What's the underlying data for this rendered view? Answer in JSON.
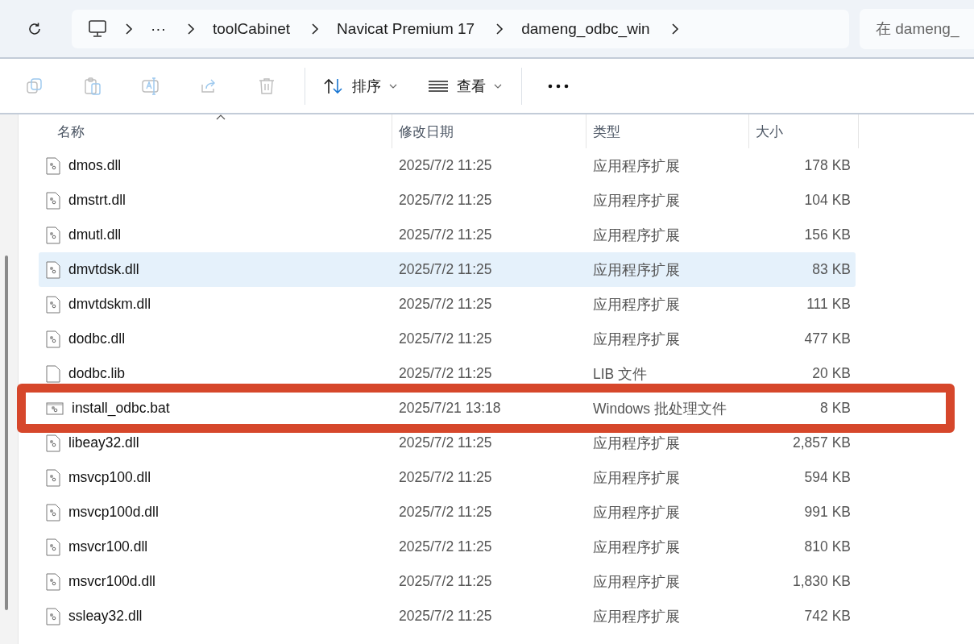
{
  "address_bar": {
    "crumbs": [
      "···",
      "toolCabinet",
      "Navicat Premium 17",
      "dameng_odbc_win"
    ]
  },
  "search": {
    "placeholder": "在 dameng_"
  },
  "toolbar": {
    "icon_buttons": [
      {
        "kind": "copy",
        "disabled": true
      },
      {
        "kind": "paste",
        "disabled": true
      },
      {
        "kind": "rename",
        "disabled": true
      },
      {
        "kind": "share",
        "disabled": true
      },
      {
        "kind": "delete",
        "disabled": true
      }
    ],
    "sort": {
      "label": "排序"
    },
    "view": {
      "label": "查看"
    }
  },
  "table": {
    "columns": [
      {
        "label": "名称",
        "sorted": true
      },
      {
        "label": "修改日期",
        "sorted": false
      },
      {
        "label": "类型",
        "sorted": false
      },
      {
        "label": "大小",
        "sorted": false
      }
    ],
    "rows": [
      {
        "name": "dmos.dll",
        "date": "2025/7/2 11:25",
        "type": "应用程序扩展",
        "size": "178 KB",
        "kind": "dll",
        "selected": false,
        "marked": false
      },
      {
        "name": "dmstrt.dll",
        "date": "2025/7/2 11:25",
        "type": "应用程序扩展",
        "size": "104 KB",
        "kind": "dll",
        "selected": false,
        "marked": false
      },
      {
        "name": "dmutl.dll",
        "date": "2025/7/2 11:25",
        "type": "应用程序扩展",
        "size": "156 KB",
        "kind": "dll",
        "selected": false,
        "marked": false
      },
      {
        "name": "dmvtdsk.dll",
        "date": "2025/7/2 11:25",
        "type": "应用程序扩展",
        "size": "83 KB",
        "kind": "dll",
        "selected": true,
        "marked": false
      },
      {
        "name": "dmvtdskm.dll",
        "date": "2025/7/2 11:25",
        "type": "应用程序扩展",
        "size": "111 KB",
        "kind": "dll",
        "selected": false,
        "marked": false
      },
      {
        "name": "dodbc.dll",
        "date": "2025/7/2 11:25",
        "type": "应用程序扩展",
        "size": "477 KB",
        "kind": "dll",
        "selected": false,
        "marked": false
      },
      {
        "name": "dodbc.lib",
        "date": "2025/7/2 11:25",
        "type": "LIB 文件",
        "size": "20 KB",
        "kind": "lib",
        "selected": false,
        "marked": false
      },
      {
        "name": "install_odbc.bat",
        "date": "2025/7/21 13:18",
        "type": "Windows 批处理文件",
        "size": "8 KB",
        "kind": "bat",
        "selected": false,
        "marked": true
      },
      {
        "name": "libeay32.dll",
        "date": "2025/7/2 11:25",
        "type": "应用程序扩展",
        "size": "2,857 KB",
        "kind": "dll",
        "selected": false,
        "marked": false
      },
      {
        "name": "msvcp100.dll",
        "date": "2025/7/2 11:25",
        "type": "应用程序扩展",
        "size": "594 KB",
        "kind": "dll",
        "selected": false,
        "marked": false
      },
      {
        "name": "msvcp100d.dll",
        "date": "2025/7/2 11:25",
        "type": "应用程序扩展",
        "size": "991 KB",
        "kind": "dll",
        "selected": false,
        "marked": false
      },
      {
        "name": "msvcr100.dll",
        "date": "2025/7/2 11:25",
        "type": "应用程序扩展",
        "size": "810 KB",
        "kind": "dll",
        "selected": false,
        "marked": false
      },
      {
        "name": "msvcr100d.dll",
        "date": "2025/7/2 11:25",
        "type": "应用程序扩展",
        "size": "1,830 KB",
        "kind": "dll",
        "selected": false,
        "marked": false
      },
      {
        "name": "ssleay32.dll",
        "date": "2025/7/2 11:25",
        "type": "应用程序扩展",
        "size": "742 KB",
        "kind": "dll",
        "selected": false,
        "marked": false
      }
    ]
  }
}
